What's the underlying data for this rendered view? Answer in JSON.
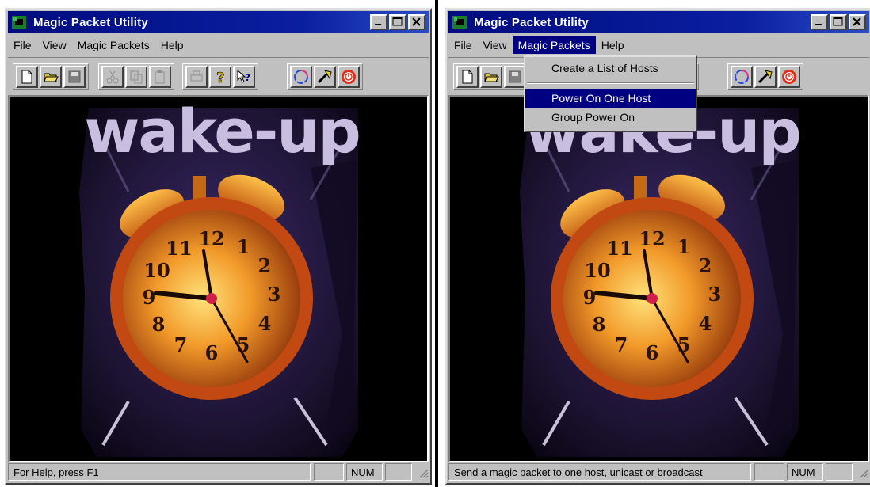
{
  "windows": [
    {
      "title": "Magic Packet Utility",
      "menu": [
        "File",
        "View",
        "Magic Packets",
        "Help"
      ],
      "open_menu": null,
      "status_text": "For Help, press F1",
      "indicator": "NUM",
      "image_caption": "wake-up"
    },
    {
      "title": "Magic Packet Utility",
      "menu": [
        "File",
        "View",
        "Magic Packets",
        "Help"
      ],
      "open_menu": "Magic Packets",
      "dropdown": [
        "Create a List of Hosts",
        "Power On One Host",
        "Group Power On"
      ],
      "highlighted_item": "Power On One Host",
      "status_text": "Send a magic packet to one host, unicast or broadcast",
      "indicator": "NUM",
      "image_caption": "wake-up"
    }
  ],
  "clock_numerals": [
    "12",
    "1",
    "2",
    "3",
    "4",
    "5",
    "6",
    "7",
    "8",
    "9",
    "10",
    "11"
  ],
  "toolbar_icons": [
    "new-file-icon",
    "open-folder-icon",
    "save-icon",
    "cut-icon",
    "copy-icon",
    "paste-icon",
    "print-icon",
    "help-icon",
    "context-help-icon",
    "refresh-icon",
    "run-icon",
    "power-icon"
  ],
  "colors": {
    "title_bar": "#000080",
    "window_face": "#c0c0c0",
    "image_background": "#1c1230",
    "wake_text": "#c9bedf"
  }
}
